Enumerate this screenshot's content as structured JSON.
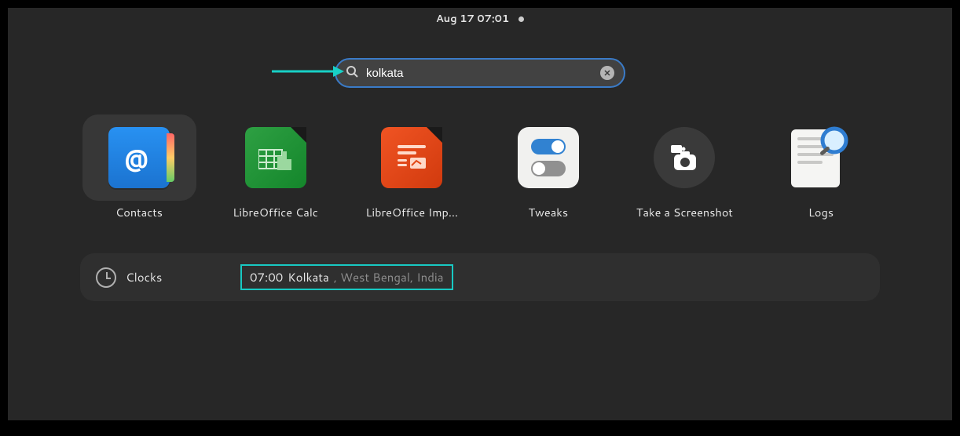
{
  "topbar": {
    "datetime": "Aug 17  07:01"
  },
  "search": {
    "value": "kolkata",
    "icon": "search-icon",
    "clear": "×"
  },
  "apps": [
    {
      "label": "Contacts",
      "icon": "contacts",
      "selected": true
    },
    {
      "label": "LibreOffice Calc",
      "icon": "calc",
      "selected": false
    },
    {
      "label": "LibreOffice Imp…",
      "icon": "impress",
      "selected": false
    },
    {
      "label": "Tweaks",
      "icon": "tweaks",
      "selected": false
    },
    {
      "label": "Take a Screenshot",
      "icon": "screenshot",
      "selected": false
    },
    {
      "label": "Logs",
      "icon": "logs",
      "selected": false
    }
  ],
  "results": {
    "clocks": {
      "provider": "Clocks",
      "time": "07:00",
      "city": "Kolkata",
      "detail": ", West Bengal, India"
    }
  }
}
